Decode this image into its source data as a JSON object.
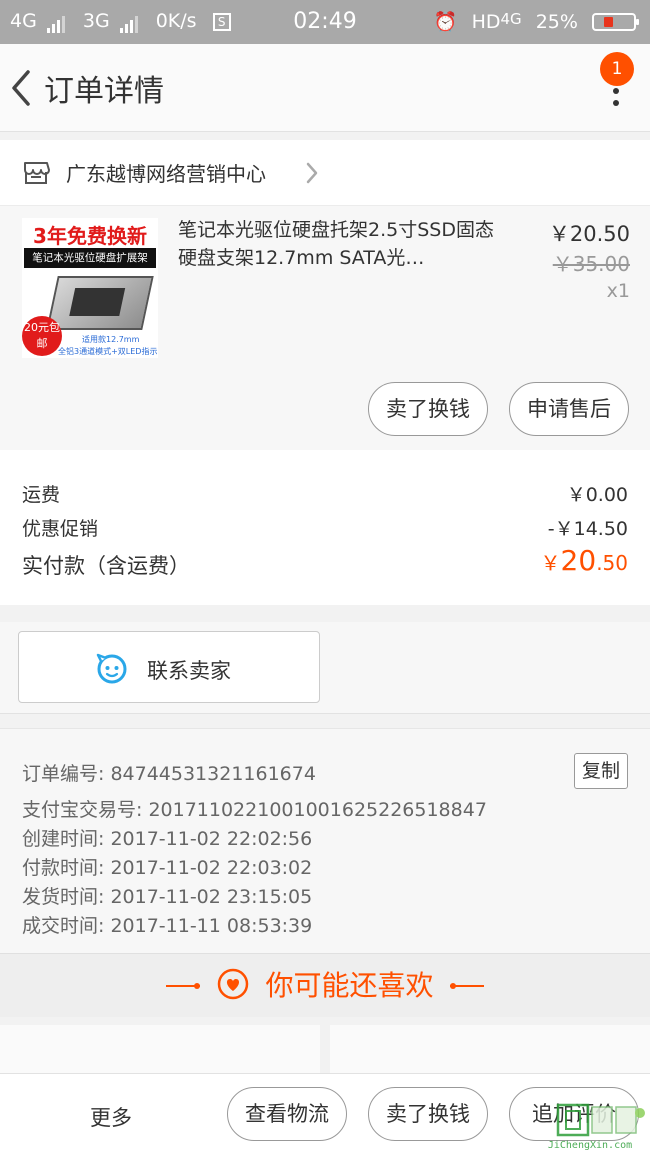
{
  "status_bar": {
    "net1": "4G",
    "net2": "3G",
    "speed": "0K/s",
    "time": "02:49",
    "hd": "HD",
    "net3": "4G",
    "battery": "25%",
    "battery_level": 0.25
  },
  "header": {
    "title": "订单详情",
    "badge": "1"
  },
  "shop": {
    "name": "广东越博网络营销中心"
  },
  "item": {
    "thumb_line1": "3年免费换新",
    "thumb_line2": "笔记本光驱位硬盘扩展架",
    "thumb_stamp": "20元包邮",
    "thumb_line3": "适用款12.7mm",
    "thumb_line4": "全铝3通道模式+双LED指示灯",
    "title": "笔记本光驱位硬盘托架2.5寸SSD固态硬盘支架12.7mm SATA光…",
    "price": "￥20.50",
    "original_price": "￥35.00",
    "quantity": "x1",
    "sell_button": "卖了换钱",
    "after_sale_button": "申请售后"
  },
  "fees": {
    "shipping_label": "运费",
    "shipping_value": "￥0.00",
    "discount_label": "优惠促销",
    "discount_value": "-￥14.50",
    "total_label": "实付款（含运费）",
    "total_currency": "￥",
    "total_int": "20",
    "total_dec": ".50"
  },
  "contact": {
    "label": "联系卖家"
  },
  "order_info": {
    "order_no": "订单编号: 84744531321161674",
    "copy_button": "复制",
    "alipay_no": "支付宝交易号: 2017110221001001625226518847",
    "created": "创建时间: 2017-11-02 22:02:56",
    "paid": "付款时间: 2017-11-02 22:03:02",
    "shipped": "发货时间: 2017-11-02 23:15:05",
    "completed": "成交时间: 2017-11-11 08:53:39"
  },
  "recommend": {
    "title": "你可能还喜欢"
  },
  "bottom_bar": {
    "more": "更多",
    "logistics_button": "查看物流",
    "sell_button": "卖了换钱",
    "review_button": "追加评价"
  },
  "watermark": {
    "text": "JiChengXin.com"
  },
  "colors": {
    "accent": "#ff5000",
    "status_bar": "#a9a9a9"
  }
}
